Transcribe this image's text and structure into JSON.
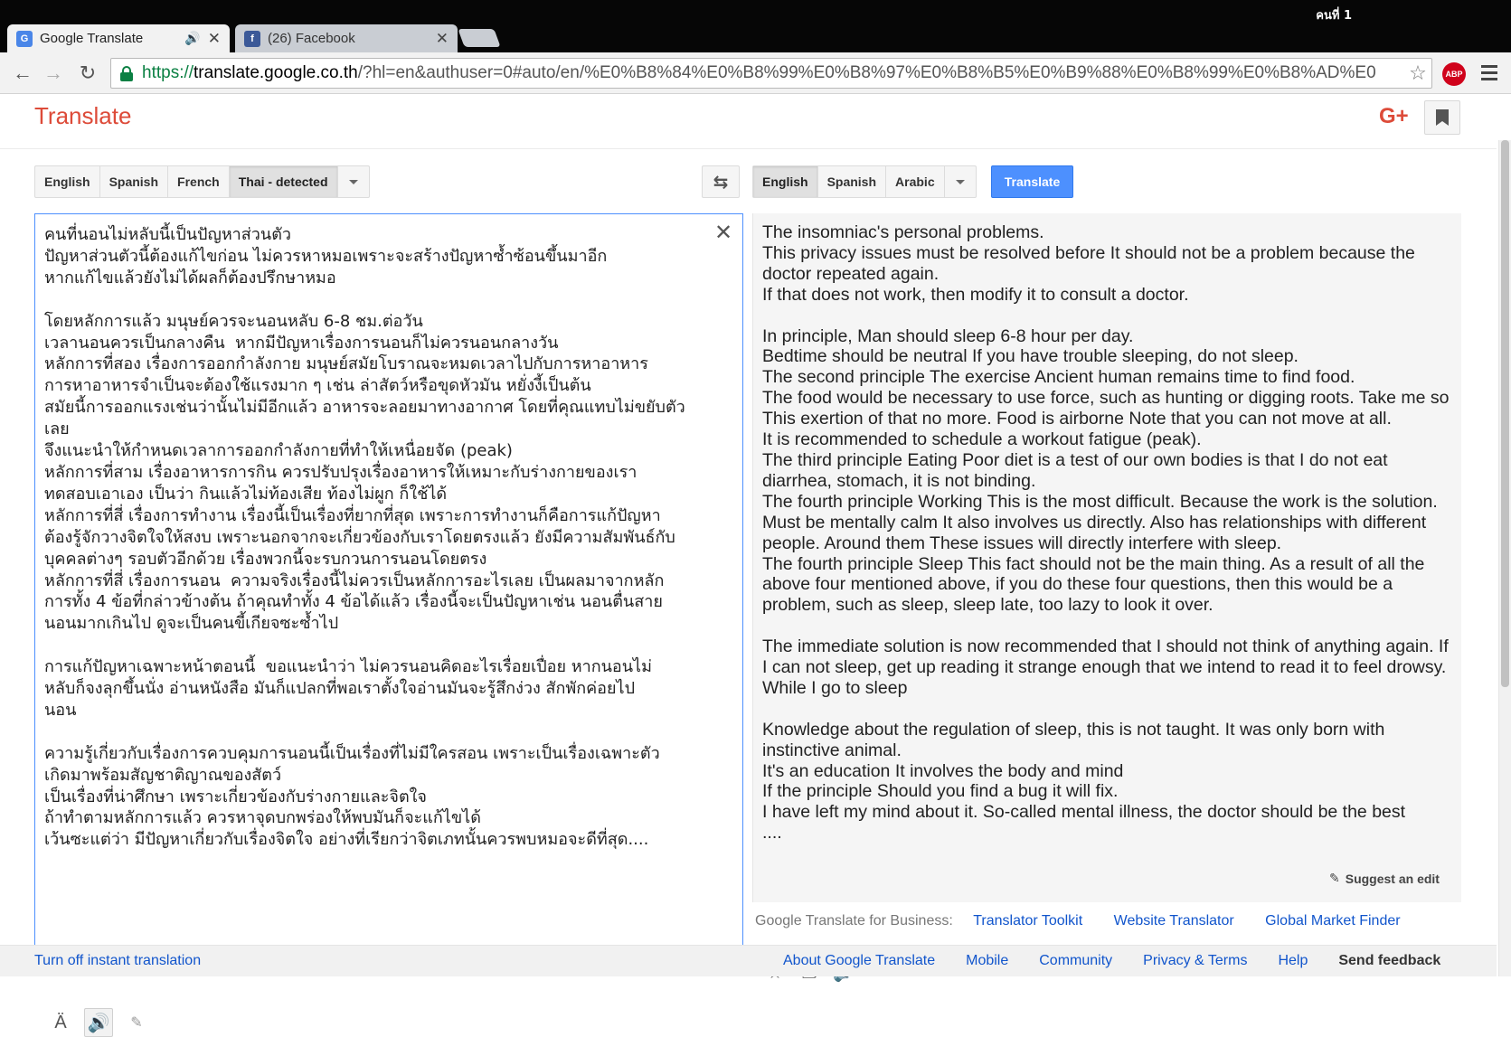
{
  "window": {
    "user_label": "คนที่ 1"
  },
  "tabs": [
    {
      "title": "Google Translate",
      "favicon": "google-translate-icon",
      "active": true,
      "audio": true
    },
    {
      "title": "(26) Facebook",
      "favicon": "facebook-icon",
      "active": false,
      "audio": false
    }
  ],
  "address_bar": {
    "scheme": "https://",
    "host": "translate.google.co.th",
    "path": "/?hl=en&authuser=0#auto/en/%E0%B8%84%E0%B8%99%E0%B8%97%E0%B8%B5%E0%B9%88%E0%B8%99%E0%B8%AD%E0"
  },
  "extensions": {
    "adblock_label": "ABP"
  },
  "header": {
    "brand": "Translate",
    "gplus": "G+"
  },
  "source_languages": [
    "English",
    "Spanish",
    "French",
    "Thai - detected"
  ],
  "target_languages": [
    "English",
    "Spanish",
    "Arabic"
  ],
  "translate_button": "Translate",
  "source_text": "คนที่นอนไม่หลับนี้เป็นปัญหาส่วนตัว\nปัญหาส่วนตัวนี้ต้องแก้ไขก่อน ไม่ควรหาหมอเพราะจะสร้างปัญหาซ้ำซ้อนขึ้นมาอีก\nหากแก้ไขแล้วยังไม่ได้ผลก็ต้องปรึกษาหมอ\n\nโดยหลักการแล้ว มนุษย์ควรจะนอนหลับ 6-8 ชม.ต่อวัน\nเวลานอนควรเป็นกลางคืน  หากมีปัญหาเรื่องการนอนก็ไม่ควรนอนกลางวัน\nหลักการที่สอง เรื่องการออกกำลังกาย มนุษย์สมัยโบราณจะหมดเวลาไปกับการหาอาหาร\nการหาอาหารจำเป็นจะต้องใช้แรงมาก ๆ เช่น ล่าสัตว์หรือขุดหัวมัน หยั่งงี้เป็นต้น\nสมัยนี้การออกแรงเช่นว่านั้นไม่มีอีกแล้ว อาหารจะลอยมาทางอากาศ โดยที่คุณแทบไม่ขยับตัวเลย\nจึงแนะนำให้กำหนดเวลาการออกกำลังกายที่ทำให้เหนื่อยจัด (peak)\nหลักการที่สาม เรื่องอาหารการกิน ควรปรับปรุงเรื่องอาหารให้เหมาะกับร่างกายของเรา\nทดสอบเอาเอง เป็นว่า กินแล้วไม่ท้องเสีย ท้องไม่ผูก ก็ใช้ได้\nหลักการที่สี่ เรื่องการทำงาน เรื่องนี้เป็นเรื่องที่ยากที่สุด เพราะการทำงานก็คือการแก้ปัญหา\nต้องรู้จักวางจิตใจให้สงบ เพราะนอกจากจะเกี่ยวข้องกับเราโดยตรงแล้ว ยังมีความสัมพันธ์กับ\nบุคคลต่างๆ รอบตัวอีกด้วย เรื่องพวกนี้จะรบกวนการนอนโดยตรง\nหลักการที่สี่ เรื่องการนอน  ความจริงเรื่องนี้ไม่ควรเป็นหลักการอะไรเลย เป็นผลมาจากหลัก\nการทั้ง 4 ข้อที่กล่าวข้างต้น ถ้าคุณทำทั้ง 4 ข้อได้แล้ว เรื่องนี้จะเป็นปัญหาเช่น นอนตื่นสาย\nนอนมากเกินไป ดูจะเป็นคนขี้เกียจซะซ้ำไป\n\nการแก้ปัญหาเฉพาะหน้าตอนนี้  ขอแนะนำว่า ไม่ควรนอนคิดอะไรเรื่อยเปื่อย หากนอนไม่\nหลับก็จงลุกขึ้นนั่ง อ่านหนังสือ มันก็แปลกที่พอเราตั้งใจอ่านมันจะรู้สึกง่วง สักพักค่อยไป\nนอน\n\nความรู้เกี่ยวกับเรื่องการควบคุมการนอนนี้เป็นเรื่องที่ไม่มีใครสอน เพราะเป็นเรื่องเฉพาะตัว\nเกิดมาพร้อมสัญชาติญาณของสัตว์\nเป็นเรื่องที่น่าศึกษา เพราะเกี่ยวข้องกับร่างกายและจิตใจ\nถ้าทำตามหลักการแล้ว ควรหาจุดบกพร่องให้พบมันก็จะแก้ไขได้\nเว้นซะแต่ว่า มีปัญหาเกี่ยวกับเรื่องจิตใจ อย่างที่เรียกว่าจิตเภทนั้นควรพบหมอจะดีที่สุด....",
  "translated_text": "The insomniac's personal problems.\nThis privacy issues must be resolved before It should not be a problem because the doctor repeated again.\nIf that does not work, then modify it to consult a doctor.\n\nIn principle, Man should sleep 6-8 hour per day.\nBedtime should be neutral If you have trouble sleeping, do not sleep.\nThe second principle The exercise Ancient human remains time to find food.\nThe food would be necessary to use force, such as hunting or digging roots. Take me so\nThis exertion of that no more. Food is airborne Note that you can not move at all.\nIt is recommended to schedule a workout fatigue (peak).\nThe third principle Eating Poor diet is a test of our own bodies is that I do not eat diarrhea, stomach, it is not binding.\nThe fourth principle Working This is the most difficult. Because the work is the solution. Must be mentally calm It also involves us directly. Also has relationships with different people. Around them These issues will directly interfere with sleep.\nThe fourth principle Sleep This fact should not be the main thing. As a result of all the above four mentioned above, if you do these four questions, then this would be a problem, such as sleep, sleep late, too lazy to look it over.\n\nThe immediate solution is now recommended that I should not think of anything again. If I can not sleep, get up reading it strange enough that we intend to read it to feel drowsy. While I go to sleep\n\nKnowledge about the regulation of sleep, this is not taught. It was only born with instinctive animal.\nIt's an education It involves the body and mind\nIf the principle Should you find a bug it will fix.\nI have left my mind about it. So-called mental illness, the doctor should be the best\n....",
  "suggest_edit": "Suggest an edit",
  "business": {
    "label": "Google Translate for Business:",
    "links": [
      "Translator Toolkit",
      "Website Translator",
      "Global Market Finder"
    ]
  },
  "footer": {
    "left": "Turn off instant translation",
    "links": [
      "About Google Translate",
      "Mobile",
      "Community",
      "Privacy & Terms",
      "Help",
      "Send feedback"
    ]
  },
  "colors": {
    "brand_red": "#dd4b39",
    "link_blue": "#1155cc",
    "button_blue": "#4d90fe"
  }
}
